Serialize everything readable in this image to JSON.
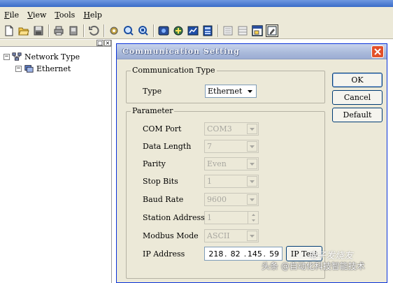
{
  "menubar": {
    "items": [
      {
        "label": "File",
        "mnemonic": "F"
      },
      {
        "label": "View",
        "mnemonic": "V"
      },
      {
        "label": "Tools",
        "mnemonic": "T"
      },
      {
        "label": "Help",
        "mnemonic": "H"
      }
    ]
  },
  "toolbar": {
    "icons": [
      "new-file-icon",
      "open-folder-icon",
      "save-icon",
      "print-icon",
      "print-preview-icon",
      "refresh-icon",
      "settings-icon",
      "search-icon",
      "search-device-icon",
      "monitor-icon",
      "config-icon",
      "chart-icon",
      "network-icon",
      "list-icon",
      "grid-icon",
      "window-icon",
      "edit-icon"
    ]
  },
  "tree": {
    "root": {
      "label": "Network Type",
      "expander": "−"
    },
    "child": {
      "label": "Ethernet",
      "expander": "−"
    }
  },
  "dialog": {
    "title": "Communication Setting",
    "comm_type_group": "Communication Type",
    "type_label": "Type",
    "type_value": "Ethernet",
    "param_group": "Parameter",
    "com_port_label": "COM Port",
    "com_port_value": "COM3",
    "data_length_label": "Data Length",
    "data_length_value": "7",
    "parity_label": "Parity",
    "parity_value": "Even",
    "stop_bits_label": "Stop Bits",
    "stop_bits_value": "1",
    "baud_rate_label": "Baud Rate",
    "baud_rate_value": "9600",
    "station_address_label": "Station Address",
    "station_address_value": "1",
    "modbus_mode_label": "Modbus Mode",
    "modbus_mode_value": "ASCII",
    "ip_address_label": "IP Address",
    "ip_octets": [
      "218",
      "82",
      "145",
      "59"
    ],
    "ip_dot": ".",
    "ip_test_label": "IP Test",
    "ok_label": "OK",
    "cancel_label": "Cancel",
    "default_label": "Default"
  },
  "watermark": {
    "text": "头条 @自动化科技智能技术",
    "logo": "电子发烧友"
  },
  "colors": {
    "window_face": "#ece9d8",
    "close_button": "#e2502a",
    "title_gradient": "#a9b9da"
  }
}
